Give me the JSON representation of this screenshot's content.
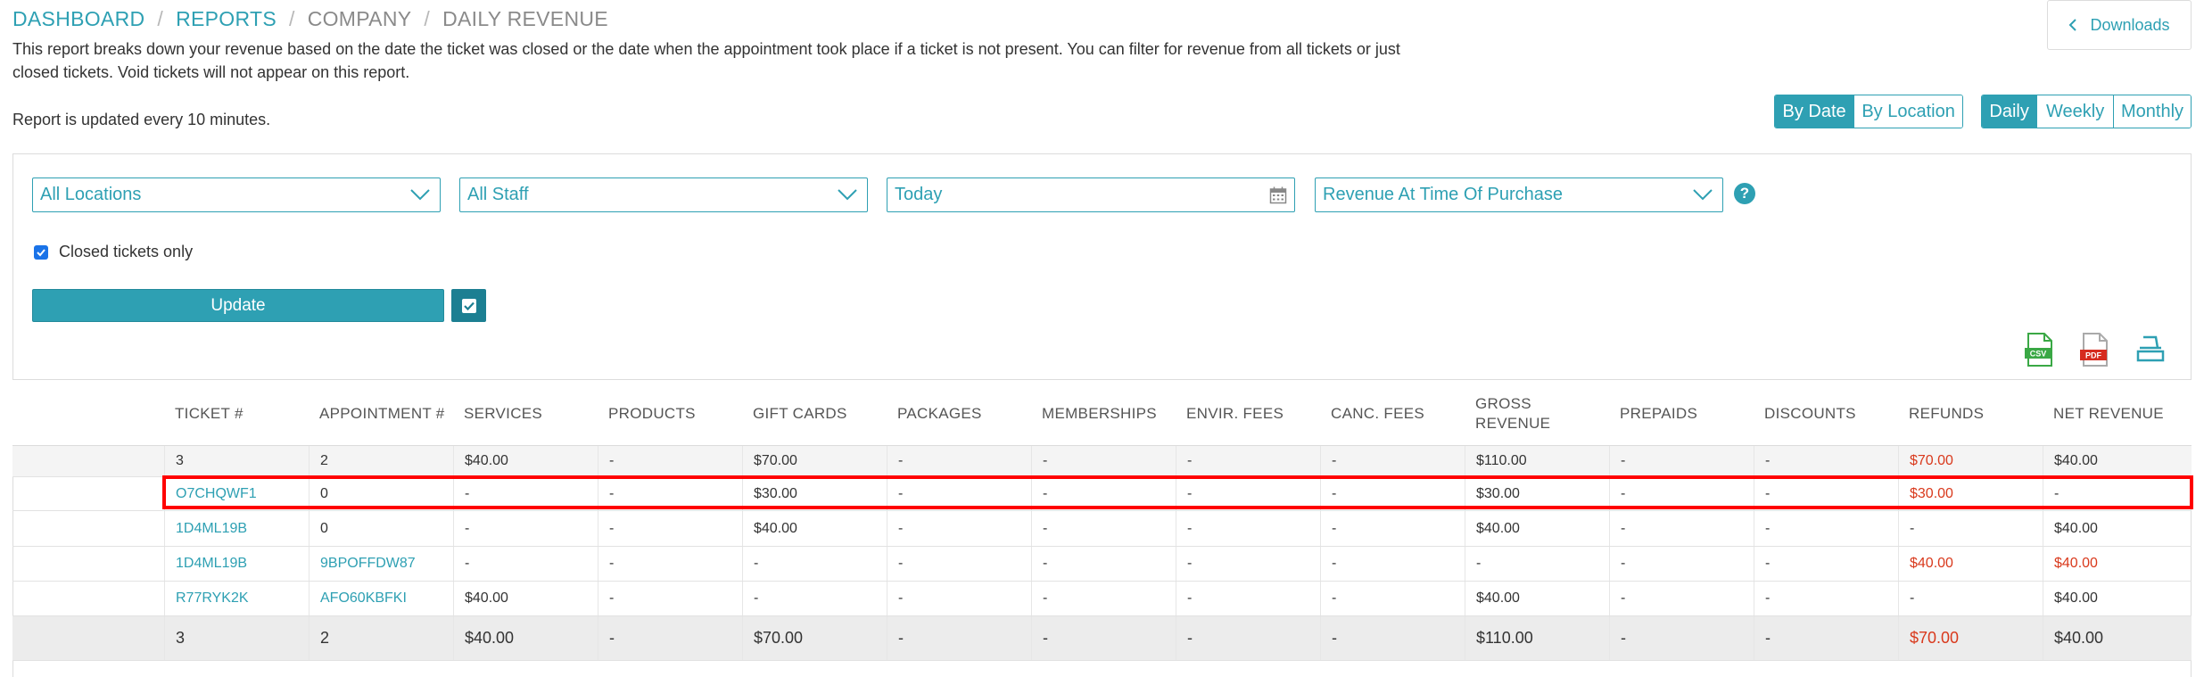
{
  "breadcrumb": {
    "items": [
      "DASHBOARD",
      "REPORTS",
      "COMPANY",
      "DAILY REVENUE"
    ],
    "separator": "/"
  },
  "description": "This report breaks down your revenue based on the date the ticket was closed or the date when the appointment took place if a ticket is not present. You can filter for revenue from all tickets or just closed tickets. Void tickets will not appear on this report.",
  "update_note": "Report is updated every 10 minutes.",
  "downloads_label": "Downloads",
  "view_toggle": {
    "by_date": "By Date",
    "by_location": "By Location",
    "active": "By Date"
  },
  "period_toggle": {
    "daily": "Daily",
    "weekly": "Weekly",
    "monthly": "Monthly",
    "active": "Daily"
  },
  "filters": {
    "location": "All Locations",
    "staff": "All Staff",
    "date": "Today",
    "revenue_type": "Revenue At Time Of Purchase"
  },
  "closed_only_label": "Closed tickets only",
  "closed_only_checked": true,
  "update_label": "Update",
  "export": {
    "csv": "CSV",
    "pdf": "PDF"
  },
  "columns": [
    "TICKET #",
    "APPOINTMENT #",
    "SERVICES",
    "PRODUCTS",
    "GIFT CARDS",
    "PACKAGES",
    "MEMBERSHIPS",
    "ENVIR. FEES",
    "CANC. FEES",
    "GROSS REVENUE",
    "PREPAIDS",
    "DISCOUNTS",
    "REFUNDS",
    "NET REVENUE"
  ],
  "rows": [
    {
      "ticket": "3",
      "appointment": "2",
      "services": "$40.00",
      "products": "-",
      "gift_cards": "$70.00",
      "packages": "-",
      "memberships": "-",
      "envir_fees": "-",
      "canc_fees": "-",
      "gross_revenue": "$110.00",
      "prepaids": "-",
      "discounts": "-",
      "refunds": "$70.00",
      "net_revenue": "$40.00"
    },
    {
      "ticket": "O7CHQWF1",
      "appointment": "0",
      "services": "-",
      "products": "-",
      "gift_cards": "$30.00",
      "packages": "-",
      "memberships": "-",
      "envir_fees": "-",
      "canc_fees": "-",
      "gross_revenue": "$30.00",
      "prepaids": "-",
      "discounts": "-",
      "refunds": "$30.00",
      "net_revenue": "-"
    },
    {
      "ticket": "1D4ML19B",
      "appointment": "0",
      "services": "-",
      "products": "-",
      "gift_cards": "$40.00",
      "packages": "-",
      "memberships": "-",
      "envir_fees": "-",
      "canc_fees": "-",
      "gross_revenue": "$40.00",
      "prepaids": "-",
      "discounts": "-",
      "refunds": "-",
      "net_revenue": "$40.00"
    },
    {
      "ticket": "1D4ML19B",
      "appointment": "9BPOFFDW87",
      "services": "-",
      "products": "-",
      "gift_cards": "-",
      "packages": "-",
      "memberships": "-",
      "envir_fees": "-",
      "canc_fees": "-",
      "gross_revenue": "-",
      "prepaids": "-",
      "discounts": "-",
      "refunds": "$40.00",
      "net_revenue": "$40.00"
    },
    {
      "ticket": "R77RYK2K",
      "appointment": "AFO60KBFKI",
      "services": "$40.00",
      "products": "-",
      "gift_cards": "-",
      "packages": "-",
      "memberships": "-",
      "envir_fees": "-",
      "canc_fees": "-",
      "gross_revenue": "$40.00",
      "prepaids": "-",
      "discounts": "-",
      "refunds": "-",
      "net_revenue": "$40.00"
    }
  ],
  "totals": {
    "ticket": "3",
    "appointment": "2",
    "services": "$40.00",
    "products": "-",
    "gift_cards": "$70.00",
    "packages": "-",
    "memberships": "-",
    "envir_fees": "-",
    "canc_fees": "-",
    "gross_revenue": "$110.00",
    "prepaids": "-",
    "discounts": "-",
    "refunds": "$70.00",
    "net_revenue": "$40.00"
  },
  "colors": {
    "accent": "#2ea0b3",
    "negative": "#d9391c",
    "highlight": "#ff0000",
    "csv_icon": "#3aa845",
    "pdf_icon": "#d62b1f"
  },
  "icons": [
    "chevron-left-icon",
    "chevron-down-icon",
    "calendar-icon",
    "help-icon",
    "check-icon",
    "calculator-icon",
    "csv-icon",
    "pdf-icon",
    "print-icon"
  ]
}
